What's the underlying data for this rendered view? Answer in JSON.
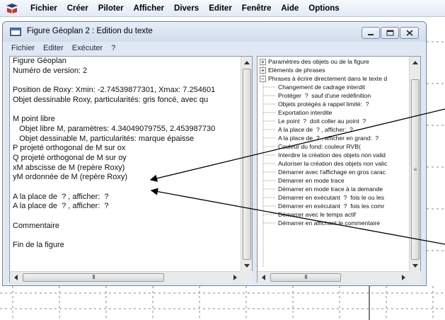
{
  "app_menu": [
    "Fichier",
    "Créer",
    "Piloter",
    "Afficher",
    "Divers",
    "Editer",
    "Fenêtre",
    "Aide",
    "Options"
  ],
  "window": {
    "title": "Figure Géoplan 2 : Edition du texte",
    "menu": [
      "Fichier",
      "Editer",
      "Exécuter",
      "?"
    ]
  },
  "text_lines": [
    "Figure Géoplan",
    "Numéro de version: 2",
    "",
    "Position de Roxy: Xmin: -2.74539877301, Xmax: 7.254601",
    "Objet dessinable Roxy, particularités: gris foncé, avec qu",
    "",
    "M point libre",
    "   Objet libre M, paramètres: 4.34049079755, 2.453987730",
    "   Objet dessinable M, particularités: marque épaisse",
    "P projeté orthogonal de M sur ox",
    "Q projeté orthogonal de M sur oy",
    "xM abscisse de M (repère Roxy)",
    "yM ordonnée de M (repère Roxy)",
    "",
    "A la place de  ? , afficher:  ?",
    "A la place de  ? , afficher:  ?",
    "",
    "Commentaire",
    "",
    "Fin de la figure"
  ],
  "tree": {
    "roots": [
      {
        "label": "Paramètres des objets ou de la figure",
        "expander": "+"
      },
      {
        "label": "Eléments de phrases",
        "expander": "+"
      },
      {
        "label": "Phrases à écrire directement dans le texte d",
        "expander": "−"
      }
    ],
    "children": [
      "Changement de cadrage interdit",
      "Protéger  ?  sauf d'une redéfinition",
      "Objets protégés à rappel limité:  ?",
      "Exportation interdite",
      "Le point  ?  doit coller au point  ?",
      "A la place de  ? , afficher:  ?",
      "A la place de  ? , afficher en grand:  ?",
      "Couleur du fond: couleur RVB(",
      "Interdire la création des objets non valid",
      "Autoriser la création des objets non valic",
      "Démarrer avec l'affichage en gros carac",
      "Démarrer en mode trace",
      "Démarrer en mode trace à la demande",
      "Démarrer en exécutant  ?  fois le ou les",
      "Démarrer en exécutant  ?  fois les comr",
      "Démarrer avec le temps actif",
      "Démarrer en affichant le commentaire"
    ]
  },
  "icons": {
    "app": "geoplan-app-icon",
    "window": "window-icon",
    "minimize": "minimize-icon",
    "maximize": "maximize-icon",
    "close": "close-icon",
    "scroll_thumb_grip": "III"
  },
  "colors": {
    "accent_window": "#dfe8f3",
    "arrow": "#000000",
    "grid_dash": "#8a8a8a"
  }
}
